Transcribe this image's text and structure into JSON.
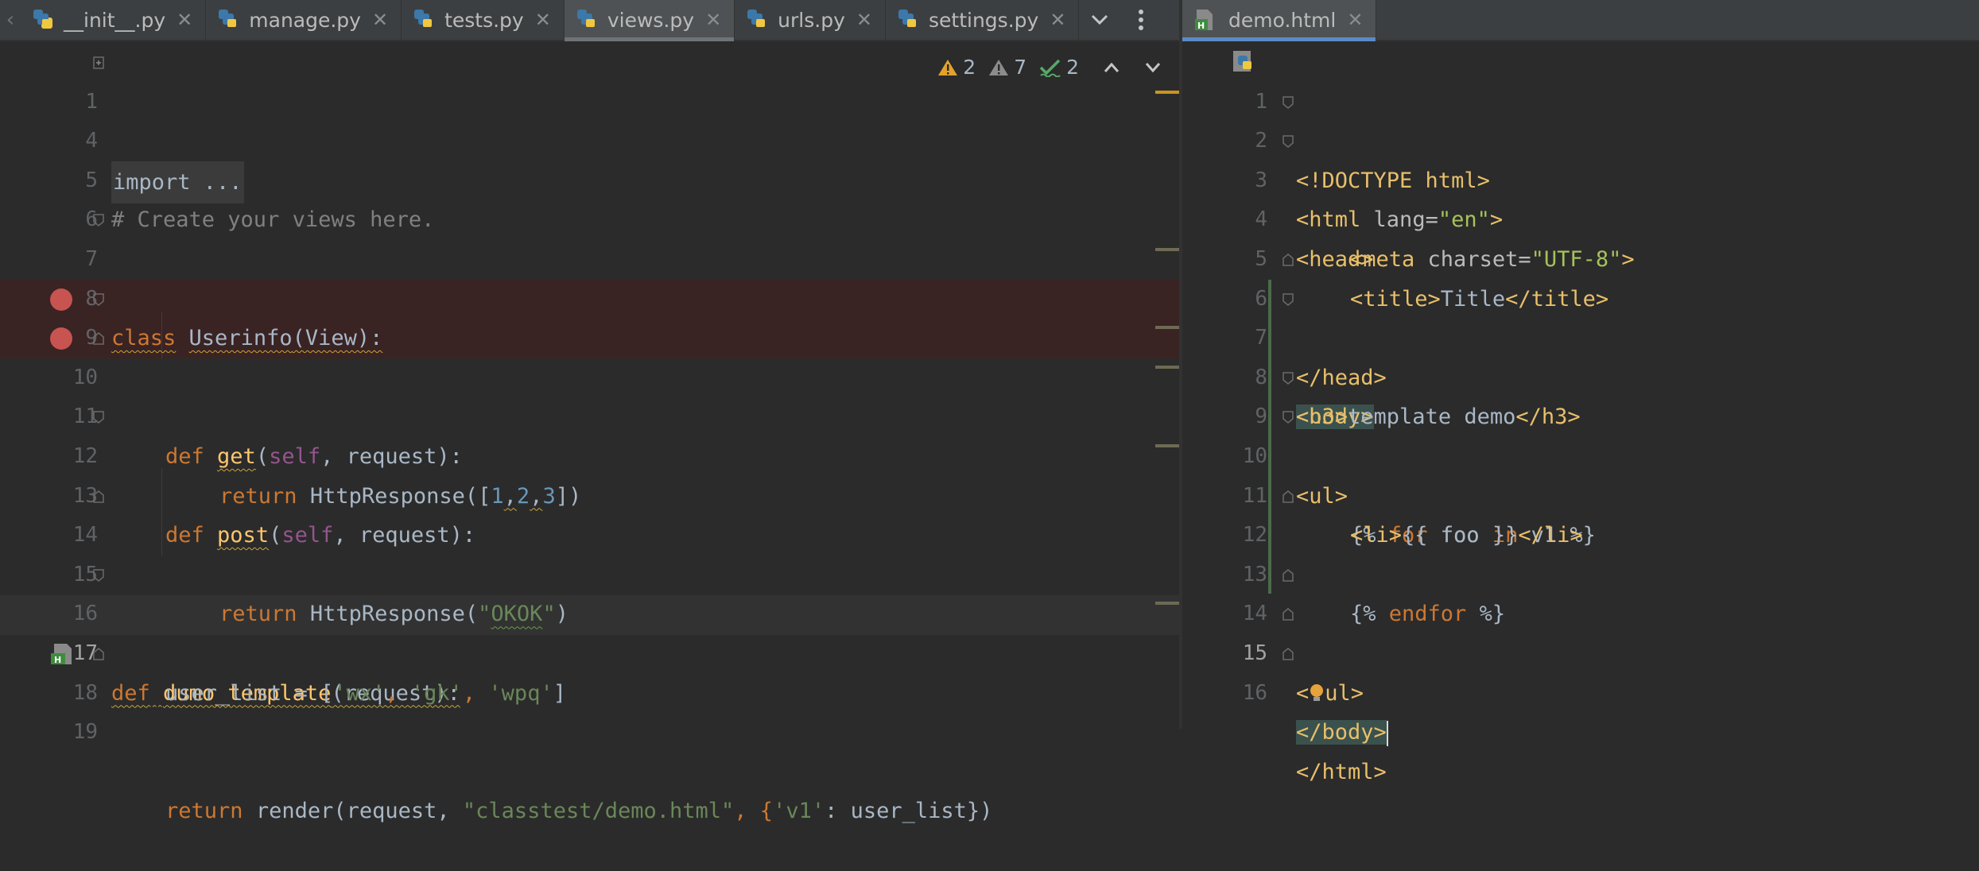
{
  "left_tabs": [
    {
      "name": "__init__.py",
      "active": false
    },
    {
      "name": "manage.py",
      "active": false
    },
    {
      "name": "tests.py",
      "active": false
    },
    {
      "name": "views.py",
      "active": true
    },
    {
      "name": "urls.py",
      "active": false
    },
    {
      "name": "settings.py",
      "active": false
    }
  ],
  "right_tabs": [
    {
      "name": "demo.html",
      "active": true
    }
  ],
  "tab_close_glyph": "✕",
  "icons": {
    "python": "python-file-icon",
    "html": "html-file-icon",
    "more": "more-vertical-icon",
    "dropdown": "chevron-down-icon",
    "breakpoint": "breakpoint-icon",
    "warning": "warning-icon",
    "weak_warning": "weak-warning-icon",
    "typo": "typo-check-icon",
    "bulb": "intention-bulb-icon"
  },
  "inspections": {
    "errors": "2",
    "warnings": "7",
    "typos": "2"
  },
  "left_editor": {
    "lines": [
      {
        "n": "1"
      },
      {
        "n": "4"
      },
      {
        "n": "5"
      },
      {
        "n": "6"
      },
      {
        "n": "7"
      },
      {
        "n": "8"
      },
      {
        "n": "9"
      },
      {
        "n": "10"
      },
      {
        "n": "11"
      },
      {
        "n": "12"
      },
      {
        "n": "13"
      },
      {
        "n": "14"
      },
      {
        "n": "15"
      },
      {
        "n": "16"
      },
      {
        "n": "17"
      },
      {
        "n": "18"
      },
      {
        "n": "19"
      }
    ],
    "t": {
      "import": "import ...",
      "comment": "# Create your views here.",
      "class_kw": "class",
      "class_name": "Userinfo",
      "class_rest": "(View):",
      "def": "def",
      "get": "get",
      "self": "self",
      "request_sig": ", request):",
      "return": "return",
      "http": "HttpResponse([",
      "one": "1",
      "comma": ",",
      "two": "2",
      "three": "3",
      "close_br": "])",
      "post": "post",
      "http2": "HttpResponse(",
      "okok_q": "\"",
      "okok": "OKOK",
      "paren_close": ")",
      "dumo": "dumo_template",
      "dumo_rest": "(request):",
      "ul_assign": "user_list = [",
      "wx": "'wx'",
      "sep": ", ",
      "gk": "'gk'",
      "wpq": "'wpq'",
      "rb": "]",
      "render": "render(request, ",
      "path": "\"classtest/demo.html\"",
      "dict_open": ", {",
      "v1": "'v1'",
      "dict_rest": ": user_list})"
    }
  },
  "right_editor": {
    "lines": [
      {
        "n": "1"
      },
      {
        "n": "2"
      },
      {
        "n": "3"
      },
      {
        "n": "4"
      },
      {
        "n": "5"
      },
      {
        "n": "6"
      },
      {
        "n": "7"
      },
      {
        "n": "8"
      },
      {
        "n": "9"
      },
      {
        "n": "10"
      },
      {
        "n": "11"
      },
      {
        "n": "12"
      },
      {
        "n": "13"
      },
      {
        "n": "14"
      },
      {
        "n": "15"
      },
      {
        "n": "16"
      }
    ],
    "t": {
      "doctype": "<!DOCTYPE html>",
      "html_open": "<html ",
      "lang": "lang=",
      "en": "\"en\"",
      "gt": ">",
      "head_open": "<head>",
      "meta_open": "<meta ",
      "charset": "charset=",
      "utf8": "\"UTF-8\"",
      "title_open": "<title>",
      "title_text": "Title",
      "title_close": "</title>",
      "head_close": "</head>",
      "body_open": "<body>",
      "h3_open": "<h3>",
      "h3_text": "template demo",
      "h3_close": "</h3>",
      "ul_open": "<ul>",
      "tpl_open": "{% ",
      "for": "for",
      "foo": " foo ",
      "in": "in",
      "v1": " v1 %}",
      "li_open": "<li>",
      "li_text": "{{ foo }}",
      "li_close": "</li>",
      "tpl_open2": "{% ",
      "endfor": "endfor",
      "tpl_close2": " %}",
      "ul_close_a": "<",
      "ul_close_b": "ul>",
      "body_close": "</body>",
      "html_close": "</html>"
    }
  }
}
